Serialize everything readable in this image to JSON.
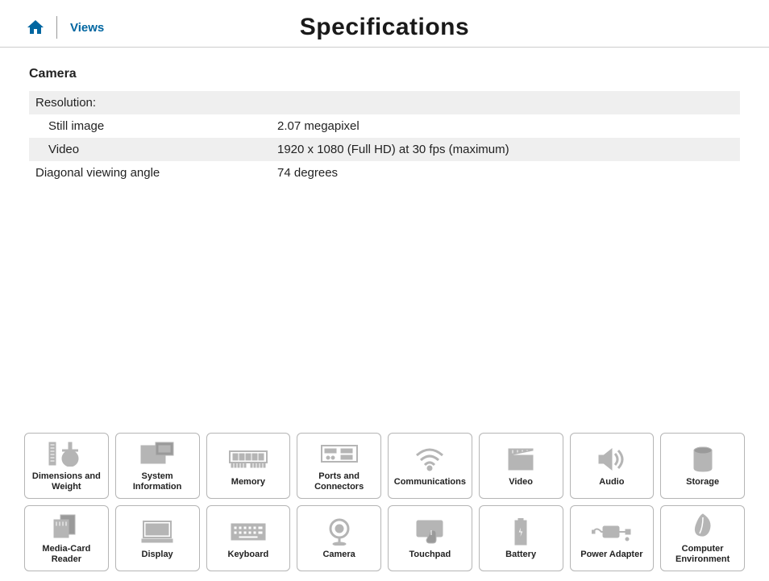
{
  "header": {
    "views_link": "Views",
    "page_title": "Specifications"
  },
  "section": {
    "title": "Camera",
    "rows": [
      {
        "label": "Resolution:",
        "value": "",
        "alt": true,
        "indent": false
      },
      {
        "label": "Still image",
        "value": "2.07 megapixel",
        "alt": false,
        "indent": true
      },
      {
        "label": "Video",
        "value": "1920 x 1080 (Full HD) at 30 fps (maximum)",
        "alt": true,
        "indent": true
      },
      {
        "label": "Diagonal viewing angle",
        "value": "74 degrees",
        "alt": false,
        "indent": false
      }
    ]
  },
  "nav": {
    "row1": [
      {
        "name": "dimensions-weight",
        "label": "Dimensions and Weight",
        "icon": "dimensions"
      },
      {
        "name": "system-information",
        "label": "System Information",
        "icon": "sysinfo"
      },
      {
        "name": "memory",
        "label": "Memory",
        "icon": "memory"
      },
      {
        "name": "ports-connectors",
        "label": "Ports and Connectors",
        "icon": "ports"
      },
      {
        "name": "communications",
        "label": "Communications",
        "icon": "wifi"
      },
      {
        "name": "video",
        "label": "Video",
        "icon": "video"
      },
      {
        "name": "audio",
        "label": "Audio",
        "icon": "audio"
      },
      {
        "name": "storage",
        "label": "Storage",
        "icon": "storage"
      }
    ],
    "row2": [
      {
        "name": "media-card-reader",
        "label": "Media-Card Reader",
        "icon": "mediacard"
      },
      {
        "name": "display",
        "label": "Display",
        "icon": "display"
      },
      {
        "name": "keyboard",
        "label": "Keyboard",
        "icon": "keyboard"
      },
      {
        "name": "camera",
        "label": "Camera",
        "icon": "camera"
      },
      {
        "name": "touchpad",
        "label": "Touchpad",
        "icon": "touchpad"
      },
      {
        "name": "battery",
        "label": "Battery",
        "icon": "battery"
      },
      {
        "name": "power-adapter",
        "label": "Power Adapter",
        "icon": "adapter"
      },
      {
        "name": "computer-environment",
        "label": "Computer Environment",
        "icon": "environment"
      }
    ]
  }
}
